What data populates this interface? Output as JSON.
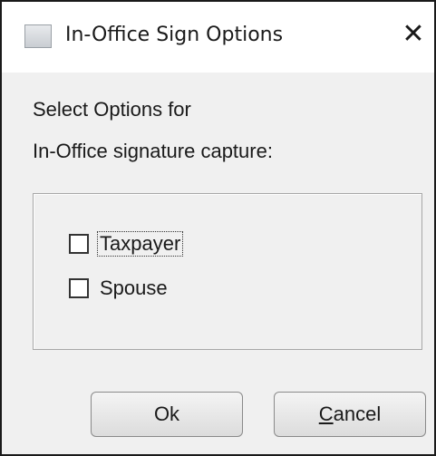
{
  "window": {
    "title": "In-Office Sign Options",
    "close_glyph": "✕"
  },
  "prompt": {
    "line1": "Select Options for",
    "line2": "In-Office signature capture:"
  },
  "options": {
    "taxpayer": {
      "label": "Taxpayer",
      "checked": false
    },
    "spouse": {
      "label": "Spouse",
      "checked": false
    }
  },
  "buttons": {
    "ok_label": "Ok",
    "cancel_mnemonic": "C",
    "cancel_rest": "ancel"
  }
}
